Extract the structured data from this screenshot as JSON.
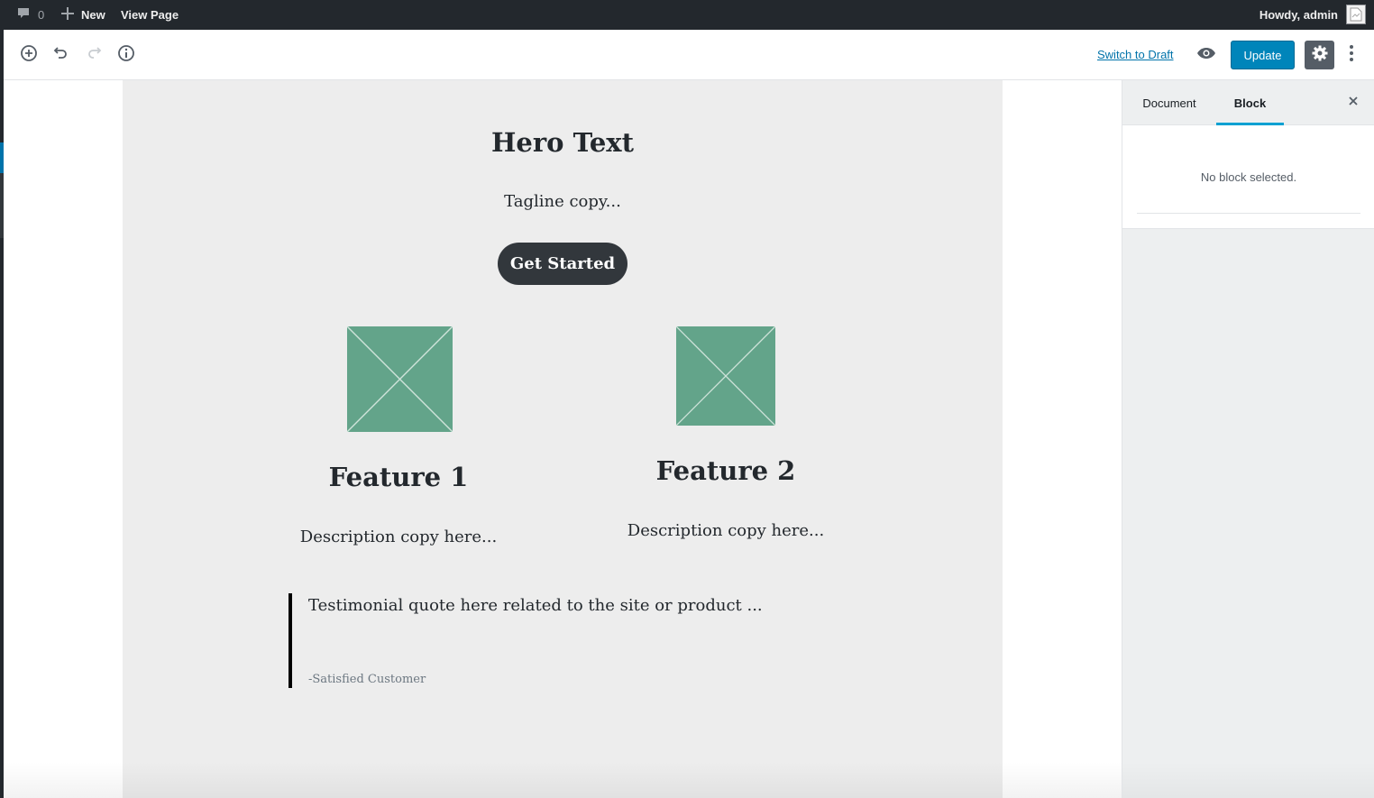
{
  "admin_bar": {
    "comments_count": "0",
    "new_label": "New",
    "view_page_label": "View Page",
    "greeting": "Howdy, admin"
  },
  "editor_header": {
    "tools": [
      {
        "name": "add-block",
        "icon": "plus-circle-icon"
      },
      {
        "name": "undo",
        "icon": "undo-icon"
      },
      {
        "name": "redo",
        "icon": "redo-icon",
        "disabled": true
      },
      {
        "name": "content-structure",
        "icon": "info-icon"
      }
    ],
    "switch_to_draft_label": "Switch to Draft",
    "update_label": "Update",
    "colors": {
      "primary": "#0085ba",
      "settings_active": "#555d66"
    }
  },
  "content": {
    "hero_title": "Hero Text",
    "tagline": "Tagline copy...",
    "cta_label": "Get Started",
    "features": [
      {
        "title": "Feature 1",
        "description": "Description copy here..."
      },
      {
        "title": "Feature 2",
        "description": "Description copy here..."
      }
    ],
    "testimonial": {
      "quote": "Testimonial quote here related to the site or product ...",
      "citation": "-Satisfied Customer"
    },
    "colors": {
      "placeholder_image": "#63a48a",
      "button": "#32373c",
      "canvas": "#ededed"
    }
  },
  "sidebar": {
    "tabs": [
      {
        "label": "Document",
        "active": false
      },
      {
        "label": "Block",
        "active": true
      }
    ],
    "empty_message": "No block selected.",
    "accent": "#00a0d2"
  }
}
